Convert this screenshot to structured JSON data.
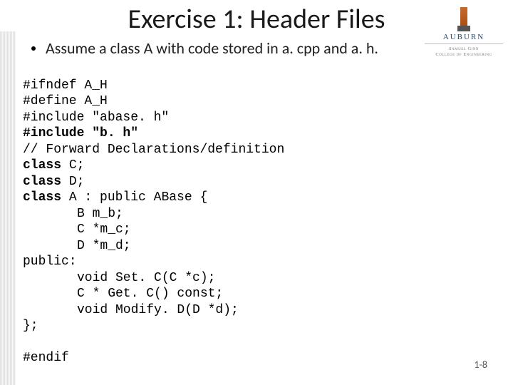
{
  "title": "Exercise 1: Header Files",
  "bullet": "Assume a class A with code stored in a. cpp and a. h.",
  "logo": {
    "name": "AUBURN",
    "sub1": "Samuel Ginn",
    "sub2": "College of Engineering"
  },
  "code": {
    "l01": "#ifndef A_H",
    "l02": "#define A_H",
    "l03": "#include \"abase. h\"",
    "l04": "#include \"b. h\"",
    "l05": "// Forward Declarations/definition",
    "l06a": "class",
    "l06b": " C;",
    "l07a": "class",
    "l07b": " D;",
    "l08a": "class",
    "l08b": " A : public ABase {",
    "l09": "B m_b;",
    "l10": "C *m_c;",
    "l11": "D *m_d;",
    "l12": "public:",
    "l13": "void Set. C(C *c);",
    "l14": "C * Get. C() const;",
    "l15": "void Modify. D(D *d);",
    "l16": "};",
    "l17": "",
    "l18": "#endif"
  },
  "pagenum": "1-8"
}
